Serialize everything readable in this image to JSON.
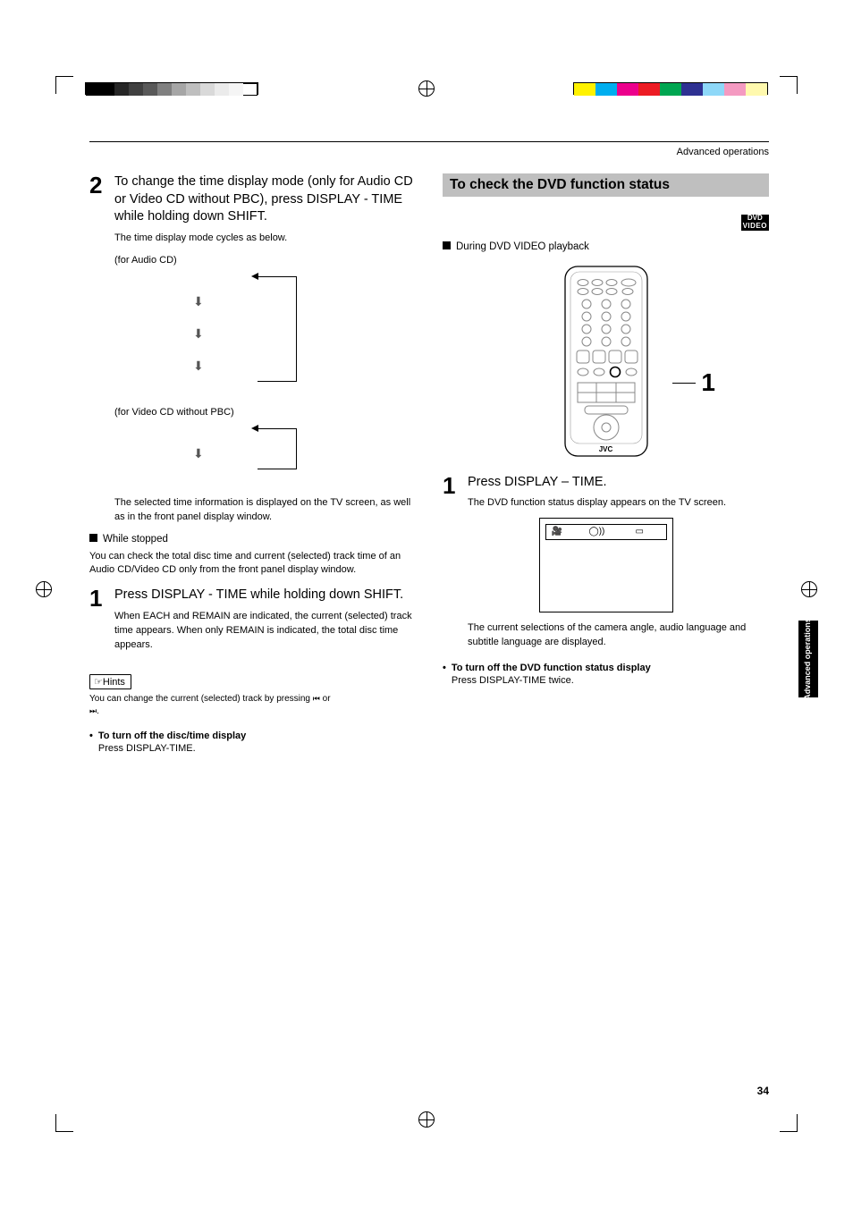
{
  "header": {
    "section": "Advanced operations"
  },
  "left": {
    "step2": {
      "title": "To change the time display mode (only for Audio CD or Video CD without PBC), press DISPLAY - TIME while holding down SHIFT.",
      "sub": "The time display mode cycles as below."
    },
    "audio_label": "(for Audio CD)",
    "video_label": "(for Video CD without PBC)",
    "selected_para": "The selected time information is displayed on the TV screen, as well as in the front panel display window.",
    "while_stopped": "While stopped",
    "stopped_para": "You can check the total disc time and current (selected) track time of an Audio CD/Video CD only from the front panel display window.",
    "step1": {
      "title": "Press DISPLAY - TIME while holding down SHIFT.",
      "sub": "When EACH and REMAIN are indicated, the current (selected) track time appears. When only REMAIN is indicated, the total disc time appears."
    },
    "hints_label": "Hints",
    "hints_text_a": "You can change the current (selected) track by pressing ",
    "hints_text_b": " or ",
    "hints_text_c": ".",
    "turn_off_bold": "To turn off the disc/time display",
    "turn_off_plain": "Press DISPLAY-TIME."
  },
  "right": {
    "section_title": "To check the DVD function status",
    "dvd_badge_top": "DVD",
    "dvd_badge_bottom": "VIDEO",
    "during": "During DVD VIDEO playback",
    "remote_brand": "JVC",
    "step1": {
      "title": "Press DISPLAY – TIME.",
      "sub": "The DVD function status display appears on the TV screen."
    },
    "after_tv": "The current selections of the camera angle, audio language and subtitle language are displayed.",
    "turn_off_bold": "To turn off the DVD function status display",
    "turn_off_plain": "Press DISPLAY-TIME twice."
  },
  "side_tab": "Advanced operations",
  "page_num": "34"
}
